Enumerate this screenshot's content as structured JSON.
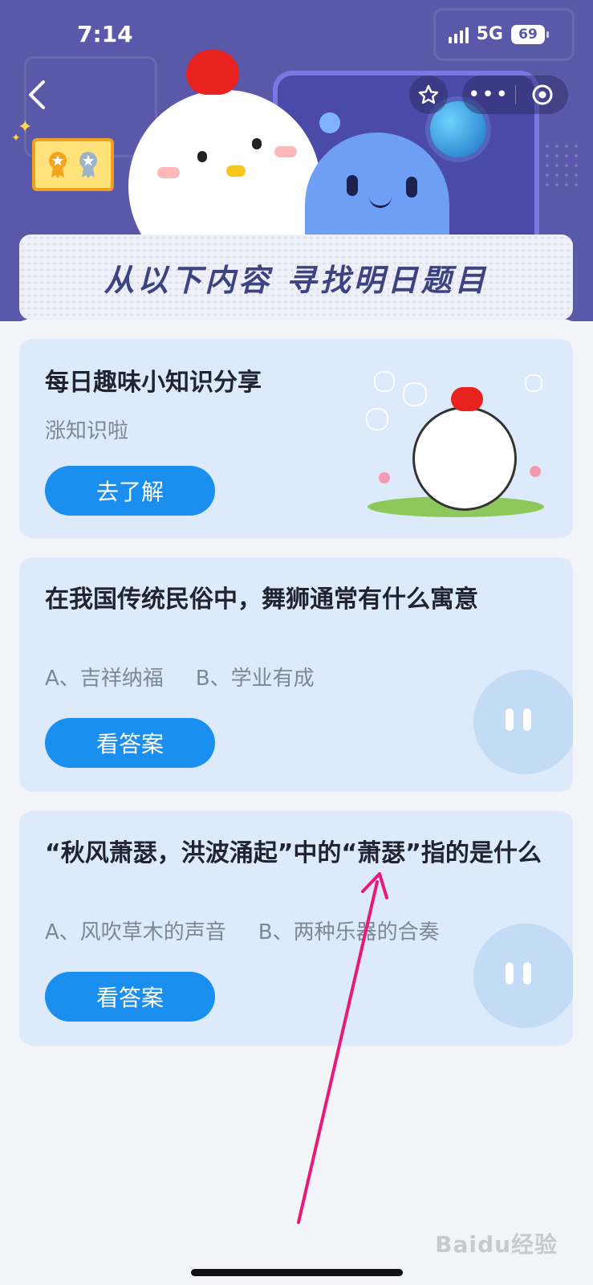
{
  "status_bar": {
    "time": "7:14",
    "network": "5G",
    "battery": "69"
  },
  "banner": {
    "title": "从以下内容 寻找明日题目"
  },
  "cards": [
    {
      "title": "每日趣味小知识分享",
      "subtitle": "涨知识啦",
      "button": "去了解"
    },
    {
      "title": "在我国传统民俗中，舞狮通常有什么寓意",
      "options": [
        "A、吉祥纳福",
        "B、学业有成"
      ],
      "button": "看答案"
    },
    {
      "title": "“秋风萧瑟，洪波涌起”中的“萧瑟”指的是什么",
      "options": [
        "A、风吹草木的声音",
        "B、两种乐器的合奏"
      ],
      "button": "看答案"
    }
  ],
  "watermark": "Baidu经验",
  "colors": {
    "header": "#5a58a8",
    "card": "#ddeafb",
    "button": "#1a8ff0",
    "arrow": "#e8197a"
  },
  "icons": [
    "back-icon",
    "star-icon",
    "more-icon",
    "target-icon",
    "medal-icon",
    "chick-mascot",
    "alien-mascot",
    "globe-icon"
  ]
}
